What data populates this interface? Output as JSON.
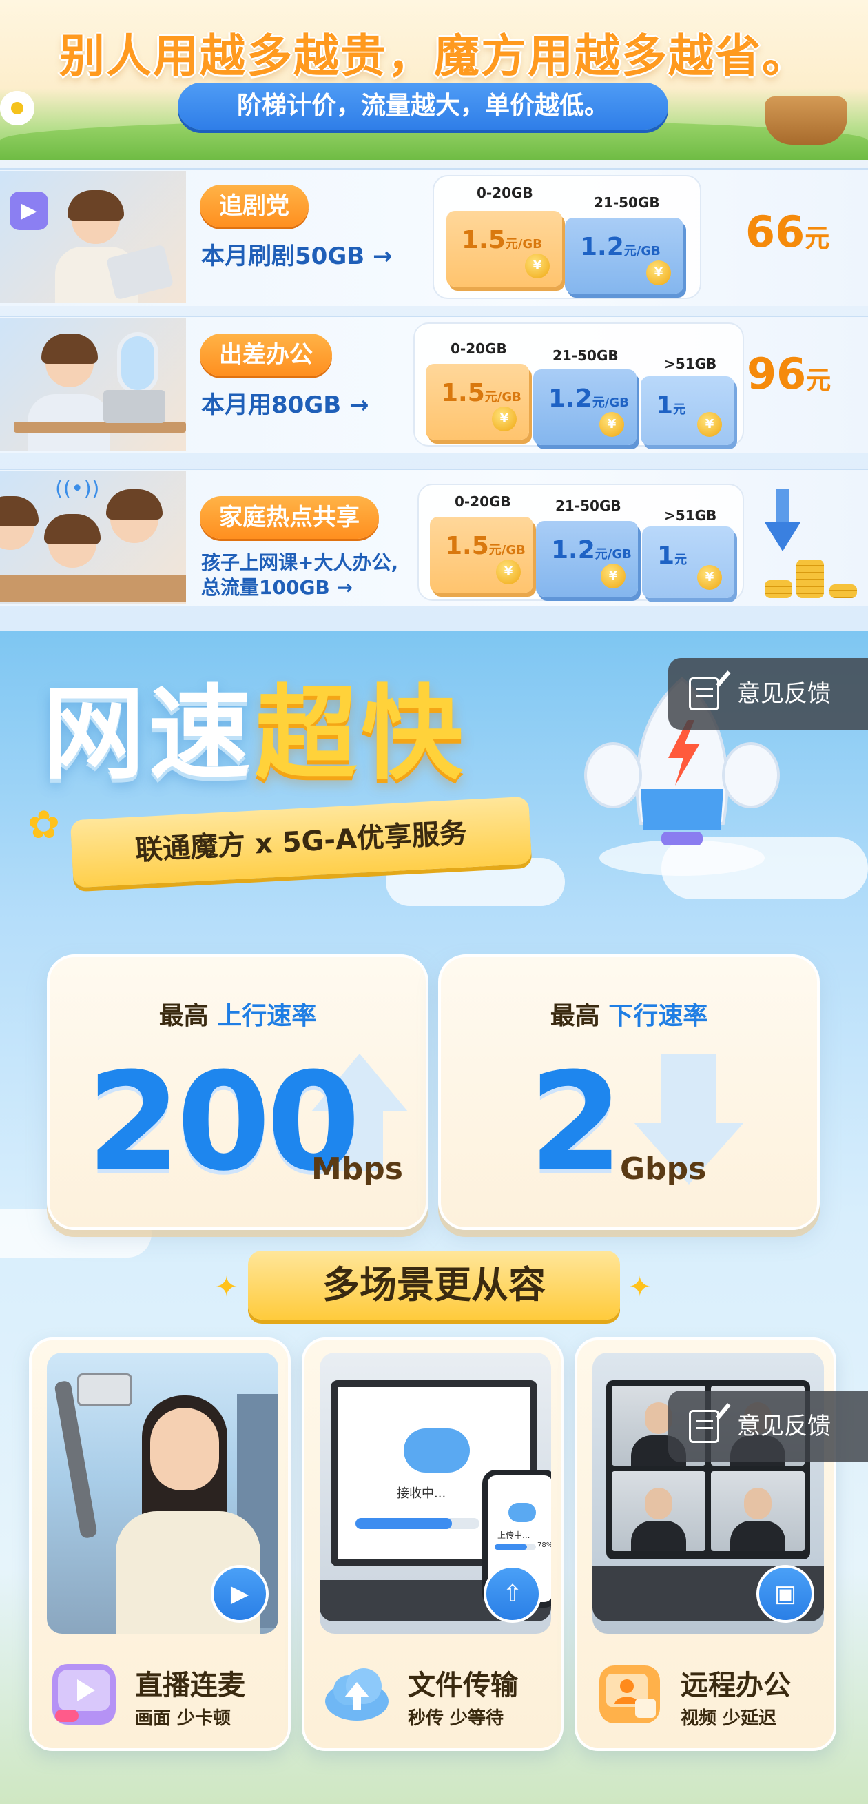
{
  "header": {
    "title": "别人用越多越贵，魔方用越多越省。",
    "subtitle": "阶梯计价，流量越大，单价越低。"
  },
  "plans": [
    {
      "tag": "追剧党",
      "desc_line1": "本月刷剧50GB →",
      "desc_line2": "",
      "tiers": [
        {
          "range": "0-20GB",
          "price": "1.5",
          "unit": "元/GB"
        },
        {
          "range": "21-50GB",
          "price": "1.2",
          "unit": "元/GB"
        }
      ],
      "total_amount": "66",
      "total_unit": "元"
    },
    {
      "tag": "出差办公",
      "desc_line1": "本月用80GB →",
      "desc_line2": "",
      "tiers": [
        {
          "range": "0-20GB",
          "price": "1.5",
          "unit": "元/GB"
        },
        {
          "range": "21-50GB",
          "price": "1.2",
          "unit": "元/GB"
        },
        {
          "range": ">51GB",
          "price": "1",
          "unit": "元"
        }
      ],
      "total_amount": "96",
      "total_unit": "元"
    },
    {
      "tag": "家庭热点共享",
      "desc_line1": "孩子上网课+大人办公,",
      "desc_line2": "总流量100GB →",
      "tiers": [
        {
          "range": "0-20GB",
          "price": "1.5",
          "unit": "元/GB"
        },
        {
          "range": "21-50GB",
          "price": "1.2",
          "unit": "元/GB"
        },
        {
          "range": ">51GB",
          "price": "1",
          "unit": "元"
        }
      ]
    }
  ],
  "coin_symbol": "¥",
  "speed": {
    "title_white": "网速",
    "title_yellow": "超快",
    "banner": "联通魔方 x 5G-A优享服务",
    "upload": {
      "prefix": "最高 ",
      "label": "上行速率",
      "value": "200",
      "unit": "Mbps"
    },
    "download": {
      "prefix": "最高 ",
      "label": "下行速率",
      "value": "2",
      "unit": "Gbps"
    }
  },
  "feedback": {
    "label": "意见反馈"
  },
  "scenes": {
    "title": "多场景更从容",
    "items": [
      {
        "name": "直播连麦",
        "sub": "画面 少卡顿",
        "icon": "live-video-icon"
      },
      {
        "name": "文件传输",
        "sub": "秒传 少等待",
        "icon": "cloud-upload-icon",
        "progress_text": "接收中...",
        "progress_pct": "78%",
        "phone_text": "上传中..."
      },
      {
        "name": "远程办公",
        "sub": "视频 少延迟",
        "icon": "briefcase-icon"
      }
    ]
  },
  "colors": {
    "accent_orange": "#ff9a1f",
    "accent_blue": "#1e86ee",
    "total_orange": "#f58a0b"
  }
}
